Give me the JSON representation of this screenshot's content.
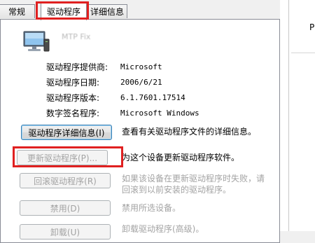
{
  "tabs": [
    {
      "label": "常规"
    },
    {
      "label": "驱动程序"
    },
    {
      "label": "详细信息"
    }
  ],
  "right_pane": {
    "text": "P"
  },
  "device": {
    "name": "MTP Fix",
    "icon": "monitor-icon"
  },
  "properties": [
    {
      "label": "驱动程序提供商:",
      "value": "Microsoft"
    },
    {
      "label": "驱动程序日期:",
      "value": "2006/6/21"
    },
    {
      "label": "驱动程序版本:",
      "value": "6.1.7601.17514"
    },
    {
      "label": "数字签名程序:",
      "value": "Microsoft Windows"
    }
  ],
  "actions": {
    "details": {
      "label": "驱动程序详细信息(I)",
      "desc": "查看有关驱动程序文件的详细信息。"
    },
    "update": {
      "label": "更新驱动程序(P)...",
      "desc": "为这个设备更新驱动程序软件。"
    },
    "rollback": {
      "label": "回滚驱动程序(R)",
      "desc_line1": "如果该设备在更新驱动程序时失败，请",
      "desc_line2": "回滚到以前安装的驱动程序。"
    },
    "disable": {
      "label": "禁用(D)",
      "desc": "禁用所选设备。"
    },
    "uninstall": {
      "label": "卸载(U)",
      "desc": "卸载驱动程序(高级)。"
    }
  },
  "colors": {
    "highlight": "#e02020",
    "disabled_text": "#a3a3a3"
  }
}
